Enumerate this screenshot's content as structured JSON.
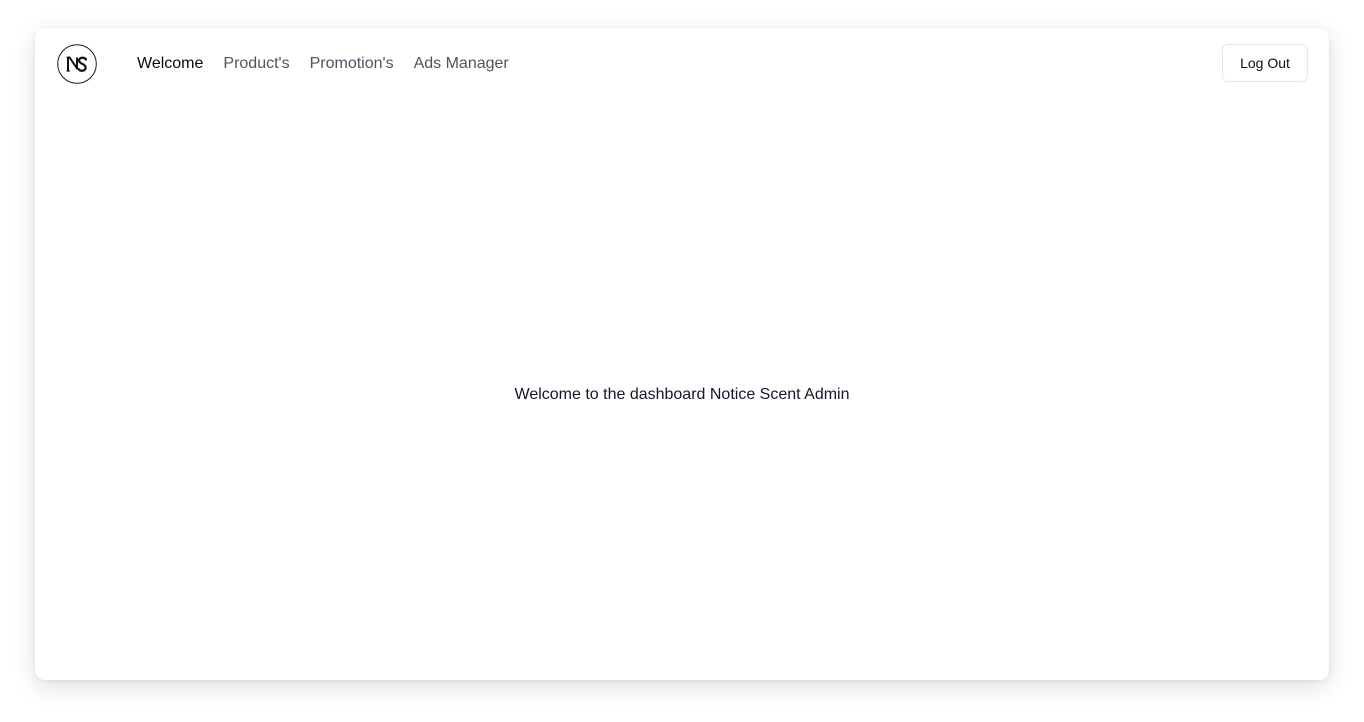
{
  "nav": {
    "items": [
      {
        "label": "Welcome",
        "active": true
      },
      {
        "label": "Product's",
        "active": false
      },
      {
        "label": "Promotion's",
        "active": false
      },
      {
        "label": "Ads Manager",
        "active": false
      }
    ]
  },
  "header": {
    "logout_label": "Log Out"
  },
  "main": {
    "welcome_text": "Welcome to the dashboard Notice Scent Admin"
  },
  "colors": {
    "nav_text": "#4b5563",
    "nav_active": "#0b0b0b",
    "border": "#e5e7eb"
  }
}
